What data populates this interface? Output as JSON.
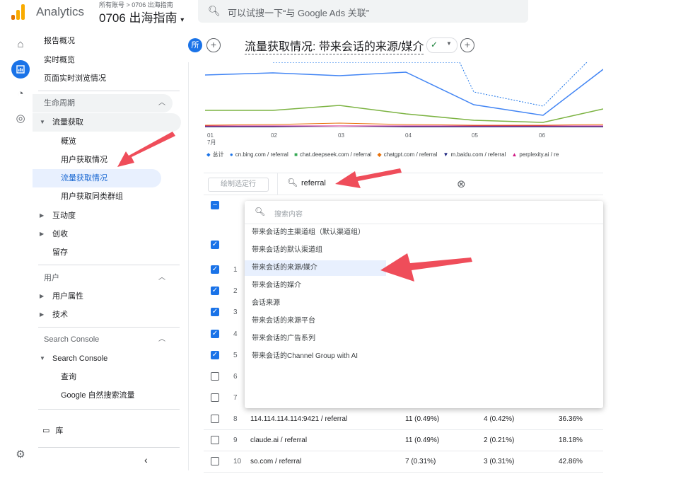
{
  "app": {
    "name": "Analytics",
    "account_path": "所有账号 > 0706 出海指南",
    "property": "0706 出海指南"
  },
  "search": {
    "placeholder": "可以试搜一下“与 Google Ads 关联”"
  },
  "sidebar": {
    "items": [
      {
        "label": "报告概况"
      },
      {
        "label": "实时概览"
      },
      {
        "label": "页面实时浏览情况"
      },
      {
        "label": "生命周期"
      },
      {
        "label": "流量获取"
      },
      {
        "label": "概览"
      },
      {
        "label": "用户获取情况"
      },
      {
        "label": "流量获取情况"
      },
      {
        "label": "用户获取同类群组"
      },
      {
        "label": "互动度"
      },
      {
        "label": "创收"
      },
      {
        "label": "留存"
      },
      {
        "label": "用户"
      },
      {
        "label": "用户属性"
      },
      {
        "label": "技术"
      },
      {
        "label": "Search Console"
      },
      {
        "label": "Search Console"
      },
      {
        "label": "查询"
      },
      {
        "label": "Google 自然搜索流量"
      },
      {
        "label": "库"
      }
    ]
  },
  "header": {
    "badge": "所",
    "title": "流量获取情况: 带来会话的来源/媒介"
  },
  "chart": {
    "x_ticks": [
      "01",
      "02",
      "03",
      "04",
      "05",
      "06"
    ],
    "month": "7月",
    "legend": [
      {
        "label": "总计",
        "color": "#1a73e8",
        "icon": "drop-marker"
      },
      {
        "label": "cn.bing.com / referral",
        "color": "#1a73e8",
        "icon": "circle-marker"
      },
      {
        "label": "chat.deepseek.com / referral",
        "color": "#34a853",
        "icon": "square-marker"
      },
      {
        "label": "chatgpt.com / referral",
        "color": "#e8710a",
        "icon": "diamond-marker"
      },
      {
        "label": "m.baidu.com / referral",
        "color": "#1a237e",
        "icon": "triangle-down-marker"
      },
      {
        "label": "perplexity.ai / re",
        "color": "#d01884",
        "icon": "triangle-up-marker"
      }
    ]
  },
  "toolbar": {
    "plot_label": "绘制选定行",
    "search_value": "referral"
  },
  "dropdown": {
    "placeholder": "搜索内容",
    "options": [
      "带来会话的主渠道组（默认渠道组）",
      "带来会话的默认渠道组",
      "带来会话的来源/媒介",
      "带来会话的媒介",
      "会话来源",
      "带来会话的来源平台",
      "带来会话的广告系列",
      "带来会话的Channel Group with AI"
    ],
    "selected_index": 2
  },
  "table": {
    "row_numbers": [
      "1",
      "2",
      "3",
      "4",
      "5",
      "6",
      "7"
    ],
    "rows": [
      {
        "num": "8",
        "source": "114.114.114.114:9421 / referral",
        "v1": "11 (0.49%)",
        "v2": "4 (0.42%)",
        "v3": "36.36%"
      },
      {
        "num": "9",
        "source": "claude.ai / referral",
        "v1": "11 (0.49%)",
        "v2": "2 (0.21%)",
        "v3": "18.18%"
      },
      {
        "num": "10",
        "source": "so.com / referral",
        "v1": "7 (0.31%)",
        "v2": "3 (0.31%)",
        "v3": "42.86%"
      }
    ]
  }
}
